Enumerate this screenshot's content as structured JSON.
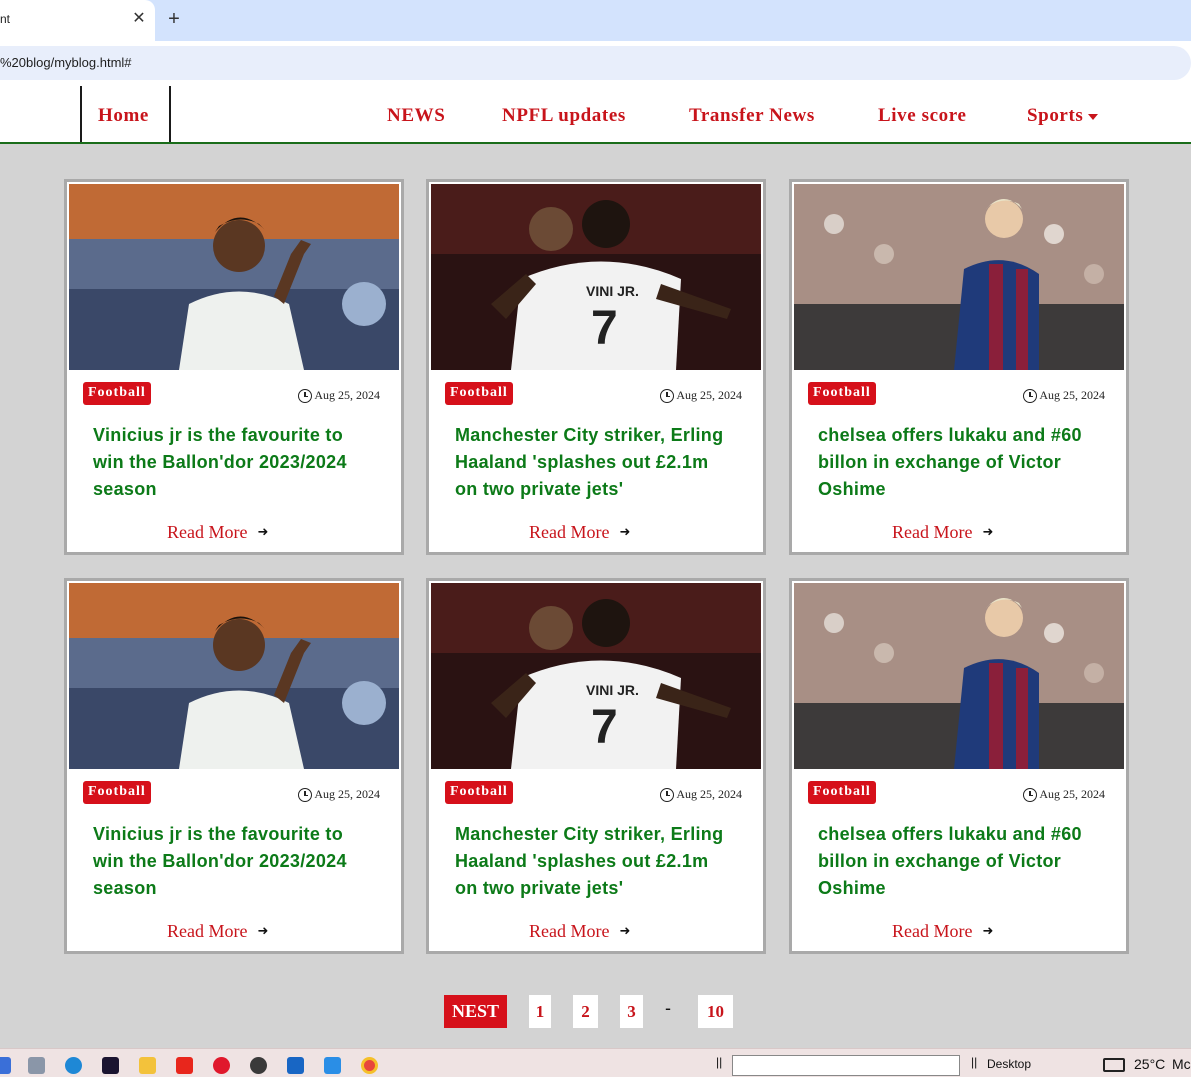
{
  "browser": {
    "tab_title": "nt",
    "tab_close": "✕",
    "new_tab": "+",
    "url": "%20blog/myblog.html#"
  },
  "nav": {
    "home": "Home",
    "items": [
      "NEWS",
      "NPFL updates",
      "Transfer News",
      "Live score"
    ],
    "sports": "Sports"
  },
  "cards": [
    {
      "badge": "Football",
      "date": "Aug 25, 2024",
      "headline": "Vinicius jr is the favourite to win the Ballon'dor 2023/2024 season",
      "read_more": "Read More",
      "image": "vinicius-pointing"
    },
    {
      "badge": "Football",
      "date": "Aug 25, 2024",
      "headline": "Manchester City striker, Erling Haaland 'splashes out £2.1m on two private jets'",
      "read_more": "Read More",
      "image": "players-hugging"
    },
    {
      "badge": "Football",
      "date": "Aug 25, 2024",
      "headline": "chelsea offers lukaku and #60 billon in exchange of Victor Oshime",
      "read_more": "Read More",
      "image": "barcelona-player"
    },
    {
      "badge": "Football",
      "date": "Aug 25, 2024",
      "headline": "Vinicius jr is the favourite to win the Ballon'dor 2023/2024 season",
      "read_more": "Read More",
      "image": "vinicius-pointing"
    },
    {
      "badge": "Football",
      "date": "Aug 25, 2024",
      "headline": "Manchester City striker, Erling Haaland 'splashes out £2.1m on two private jets'",
      "read_more": "Read More",
      "image": "players-hugging"
    },
    {
      "badge": "Football",
      "date": "Aug 25, 2024",
      "headline": "chelsea offers lukaku and #60 billon in exchange of Victor Oshime",
      "read_more": "Read More",
      "image": "barcelona-player"
    }
  ],
  "pagination": {
    "next": "NEST",
    "pages": [
      "1",
      "2",
      "3"
    ],
    "dash": "-",
    "last": "10"
  },
  "taskbar": {
    "desktop": "Desktop",
    "temp": "25°C",
    "weather_trunc": "Mc"
  },
  "colors": {
    "brand_red": "#c8141b",
    "headline_green": "#0c7a18",
    "page_bg": "#d3d3d3"
  }
}
